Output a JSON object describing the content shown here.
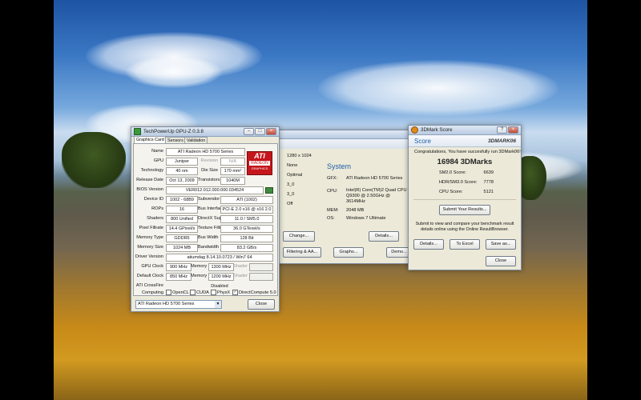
{
  "gpuz": {
    "title": "TechPowerUp GPU-Z 0.3.8",
    "tabs": [
      "Graphics Card",
      "Sensors",
      "Validation"
    ],
    "name_label": "Name",
    "name": "ATI Radeon HD 5700 Series",
    "gpu_label": "GPU",
    "gpu": "Juniper",
    "revision_label": "Revision",
    "revision": "N/A",
    "technology_label": "Technology",
    "technology": "40 nm",
    "die_size_label": "Die Size",
    "die_size": "170 mm²",
    "release_date_label": "Release Date",
    "release_date": "Oct 13, 2009",
    "transistors_label": "Transistors",
    "transistors": "1040M",
    "bios_label": "BIOS Version",
    "bios": "VER012.012.000.000.034524",
    "device_id_label": "Device ID",
    "device_id": "1002 - 68B9",
    "subvendor_label": "Subvendor",
    "subvendor": "ATI (1002)",
    "rops_label": "ROPs",
    "rops": "16",
    "bus_label": "Bus Interface",
    "bus": "PCI-E 2.0 x16 @ x16 2.0",
    "shaders_label": "Shaders",
    "shaders": "800 Unified",
    "directx_label": "DirectX Support",
    "directx": "11.0 / SM5.0",
    "pixel_label": "Pixel Fillrate",
    "pixel": "14.4 GPixel/s",
    "texture_label": "Texture Fillrate",
    "texture": "36.0 GTexel/s",
    "memtype_label": "Memory Type",
    "memtype": "GDDR5",
    "buswidth_label": "Bus Width",
    "buswidth": "128 Bit",
    "memsize_label": "Memory Size",
    "memsize": "1024 MB",
    "bandwidth_label": "Bandwidth",
    "bandwidth": "83.2 GB/s",
    "driver_label": "Driver Version",
    "driver": "atiumdag 8.14.10.0723 / Win7 64",
    "gpuclock_label": "GPU Clock",
    "gpuclock": "900 MHz",
    "memory_label": "Memory",
    "memclock": "1300 MHz",
    "shader_label": "Shader",
    "defclock_label": "Default Clock",
    "defclock": "850 MHz",
    "defmem": "1200 MHz",
    "crossfire_label": "ATI CrossFire",
    "crossfire": "Disabled",
    "computing_label": "Computing",
    "opencl": "OpenCL",
    "cuda": "CUDA",
    "physx": "PhysX",
    "directcompute": "DirectCompute 5.0",
    "select_value": "ATI Radeon HD 5700 Series",
    "close": "Close",
    "logo_line1": "ATI",
    "logo_line2": "RADEON",
    "logo_line3": "GRAPHICS"
  },
  "mid": {
    "settings": [
      "1280 x 1024",
      "None",
      "Optimal",
      "3_0",
      "3_0",
      "Off"
    ],
    "system_header": "System",
    "gfx_label": "GFX:",
    "gfx": "ATI Radeon HD 5700 Series",
    "cpu_label": "CPU:",
    "cpu": "Intel(R) Core(TM)2 Quad CPU Q9300 @ 2.50GHz @ 3614MHz",
    "mem_label": "MEM:",
    "mem": "2048 MB",
    "os_label": "OS:",
    "os": "Windows 7 Ultimate",
    "btn_change": "Change...",
    "btn_details": "Details...",
    "btn_filtering": "Filtering & AA...",
    "btn_graphs": "Graphs...",
    "btn_demo": "Demo..."
  },
  "score": {
    "title": "3DMark Score",
    "header": "Score",
    "brand": "3DMARK06",
    "congrats": "Congratulations, You have succesfully run 3DMark06!",
    "total": "16984 3DMarks",
    "sm2_label": "SM2.0 Score:",
    "sm2": "6639",
    "hdr_label": "HDR/SM3.0 Score:",
    "hdr": "7778",
    "cpu_label": "CPU Score:",
    "cpu": "5121",
    "submit": "Submit Your Results...",
    "note": "Submit to view and compare your benchmark result details online using the Online ResultBrowser.",
    "details": "Details...",
    "excel": "To Excel",
    "saveas": "Save as...",
    "close": "Close"
  },
  "colors": {
    "accent": "#1f5fa8",
    "ati_red": "#c4161c"
  }
}
